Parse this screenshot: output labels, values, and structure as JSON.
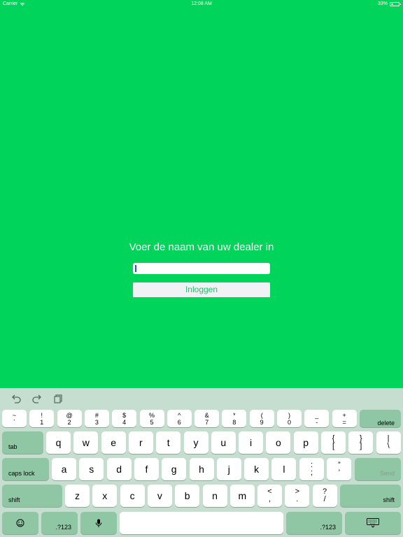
{
  "status_bar": {
    "carrier": "Carrier",
    "time": "12:08 AM",
    "battery": "33%",
    "battery_level": 0.33
  },
  "login": {
    "prompt": "Voer de naam van uw dealer in",
    "input_value": "",
    "button_label": "Inloggen"
  },
  "keyboard": {
    "toolbar_icons": [
      "undo-icon",
      "redo-icon",
      "paste-icon"
    ],
    "number_row": [
      {
        "top": "~",
        "bottom": "`"
      },
      {
        "top": "!",
        "bottom": "1"
      },
      {
        "top": "@",
        "bottom": "2"
      },
      {
        "top": "#",
        "bottom": "3"
      },
      {
        "top": "$",
        "bottom": "4"
      },
      {
        "top": "%",
        "bottom": "5"
      },
      {
        "top": "^",
        "bottom": "6"
      },
      {
        "top": "&",
        "bottom": "7"
      },
      {
        "top": "*",
        "bottom": "8"
      },
      {
        "top": "(",
        "bottom": "9"
      },
      {
        "top": ")",
        "bottom": "0"
      },
      {
        "top": "_",
        "bottom": "-"
      },
      {
        "top": "+",
        "bottom": "="
      }
    ],
    "delete": "delete",
    "tab": "tab",
    "row1": [
      "q",
      "w",
      "e",
      "r",
      "t",
      "y",
      "u",
      "i",
      "o",
      "p"
    ],
    "row1_extra": [
      {
        "top": "{",
        "bottom": "["
      },
      {
        "top": "}",
        "bottom": "]"
      },
      {
        "top": "|",
        "bottom": "\\"
      }
    ],
    "caps_lock": "caps lock",
    "row2": [
      "a",
      "s",
      "d",
      "f",
      "g",
      "h",
      "j",
      "k",
      "l"
    ],
    "row2_extra": [
      {
        "top": ":",
        "bottom": ";"
      },
      {
        "top": "”",
        "bottom": "’"
      }
    ],
    "send": "Send",
    "shift": "shift",
    "row3": [
      "z",
      "x",
      "c",
      "v",
      "b",
      "n",
      "m"
    ],
    "row3_extra": [
      {
        "top": "<",
        "bottom": ","
      },
      {
        "top": ">",
        "bottom": "."
      },
      {
        "top": "?",
        "bottom": "/"
      }
    ],
    "numbers_toggle": ".?123",
    "emoji_icon": "emoji-icon",
    "mic_icon": "mic-icon",
    "dismiss_icon": "keyboard-dismiss-icon"
  }
}
